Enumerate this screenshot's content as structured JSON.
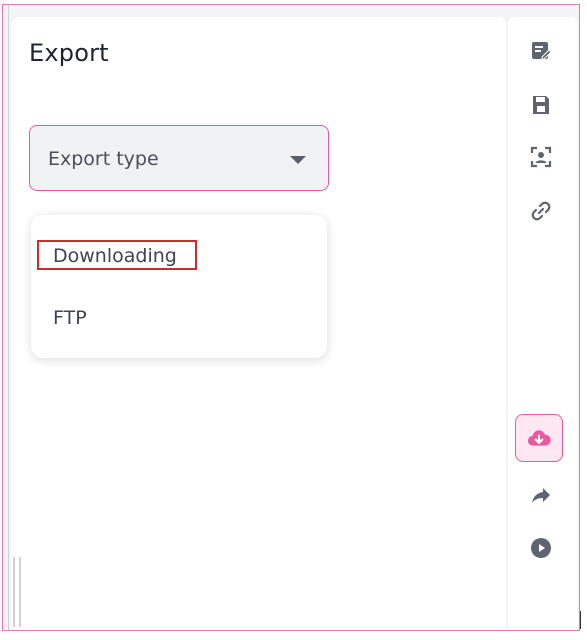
{
  "panel": {
    "title": "Export"
  },
  "select": {
    "label": "Export type"
  },
  "menu": {
    "items": [
      {
        "label": "Downloading",
        "highlighted": true
      },
      {
        "label": "FTP",
        "highlighted": false
      }
    ]
  },
  "rail": {
    "icons": [
      "edit-note-icon",
      "save-icon",
      "face-scan-icon",
      "link-icon",
      "cloud-download-icon",
      "share-arrow-icon",
      "play-circle-icon"
    ],
    "active": "cloud-download-icon",
    "accent": "#e85aa0",
    "icon_color": "#5f6470"
  },
  "colors": {
    "accent": "#e85aa0",
    "highlight_border": "#d22a2a",
    "panel_bg": "#ffffff",
    "frame_bg": "#f3f4f6"
  }
}
